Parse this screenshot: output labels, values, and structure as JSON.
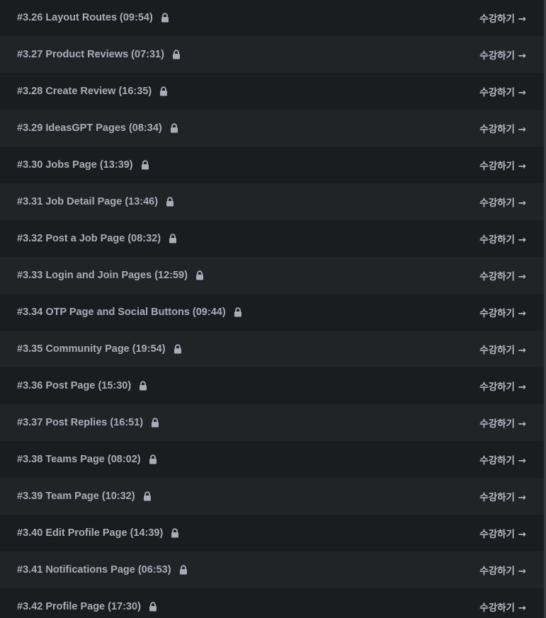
{
  "colors": {
    "row_dark": "#1b1c1f",
    "row_light": "#222327",
    "text": "#a9adb8",
    "cta": "#b9bdc7"
  },
  "lessons": [
    {
      "label": "#3.26 Layout Routes (09:54)",
      "locked": true,
      "cta": "수강하기 →"
    },
    {
      "label": "#3.27 Product Reviews (07:31)",
      "locked": true,
      "cta": "수강하기 →"
    },
    {
      "label": "#3.28 Create Review (16:35)",
      "locked": true,
      "cta": "수강하기 →"
    },
    {
      "label": "#3.29 IdeasGPT Pages (08:34)",
      "locked": true,
      "cta": "수강하기 →"
    },
    {
      "label": "#3.30 Jobs Page (13:39)",
      "locked": true,
      "cta": "수강하기 →"
    },
    {
      "label": "#3.31 Job Detail Page (13:46)",
      "locked": true,
      "cta": "수강하기 →"
    },
    {
      "label": "#3.32 Post a Job Page (08:32)",
      "locked": true,
      "cta": "수강하기 →"
    },
    {
      "label": "#3.33 Login and Join Pages (12:59)",
      "locked": true,
      "cta": "수강하기 →"
    },
    {
      "label": "#3.34 OTP Page and Social Buttons (09:44)",
      "locked": true,
      "cta": "수강하기 →"
    },
    {
      "label": "#3.35 Community Page (19:54)",
      "locked": true,
      "cta": "수강하기 →"
    },
    {
      "label": "#3.36 Post Page (15:30)",
      "locked": true,
      "cta": "수강하기 →"
    },
    {
      "label": "#3.37 Post Replies (16:51)",
      "locked": true,
      "cta": "수강하기 →"
    },
    {
      "label": "#3.38 Teams Page (08:02)",
      "locked": true,
      "cta": "수강하기 →"
    },
    {
      "label": "#3.39 Team Page (10:32)",
      "locked": true,
      "cta": "수강하기 →"
    },
    {
      "label": "#3.40 Edit Profile Page (14:39)",
      "locked": true,
      "cta": "수강하기 →"
    },
    {
      "label": "#3.41 Notifications Page (06:53)",
      "locked": true,
      "cta": "수강하기 →"
    },
    {
      "label": "#3.42 Profile Page (17:30)",
      "locked": true,
      "cta": "수강하기 →"
    }
  ]
}
